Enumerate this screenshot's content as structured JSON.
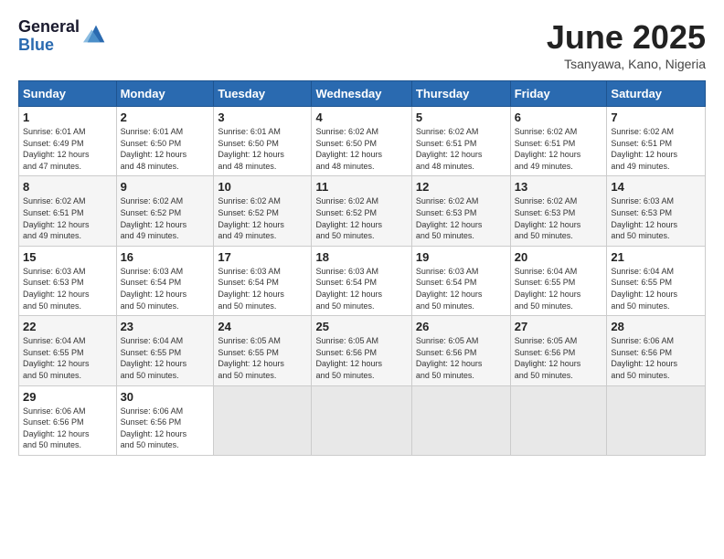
{
  "header": {
    "logo_general": "General",
    "logo_blue": "Blue",
    "month_year": "June 2025",
    "location": "Tsanyawa, Kano, Nigeria"
  },
  "weekdays": [
    "Sunday",
    "Monday",
    "Tuesday",
    "Wednesday",
    "Thursday",
    "Friday",
    "Saturday"
  ],
  "weeks": [
    [
      {
        "day": "1",
        "info": "Sunrise: 6:01 AM\nSunset: 6:49 PM\nDaylight: 12 hours\nand 47 minutes."
      },
      {
        "day": "2",
        "info": "Sunrise: 6:01 AM\nSunset: 6:50 PM\nDaylight: 12 hours\nand 48 minutes."
      },
      {
        "day": "3",
        "info": "Sunrise: 6:01 AM\nSunset: 6:50 PM\nDaylight: 12 hours\nand 48 minutes."
      },
      {
        "day": "4",
        "info": "Sunrise: 6:02 AM\nSunset: 6:50 PM\nDaylight: 12 hours\nand 48 minutes."
      },
      {
        "day": "5",
        "info": "Sunrise: 6:02 AM\nSunset: 6:51 PM\nDaylight: 12 hours\nand 48 minutes."
      },
      {
        "day": "6",
        "info": "Sunrise: 6:02 AM\nSunset: 6:51 PM\nDaylight: 12 hours\nand 49 minutes."
      },
      {
        "day": "7",
        "info": "Sunrise: 6:02 AM\nSunset: 6:51 PM\nDaylight: 12 hours\nand 49 minutes."
      }
    ],
    [
      {
        "day": "8",
        "info": "Sunrise: 6:02 AM\nSunset: 6:51 PM\nDaylight: 12 hours\nand 49 minutes."
      },
      {
        "day": "9",
        "info": "Sunrise: 6:02 AM\nSunset: 6:52 PM\nDaylight: 12 hours\nand 49 minutes."
      },
      {
        "day": "10",
        "info": "Sunrise: 6:02 AM\nSunset: 6:52 PM\nDaylight: 12 hours\nand 49 minutes."
      },
      {
        "day": "11",
        "info": "Sunrise: 6:02 AM\nSunset: 6:52 PM\nDaylight: 12 hours\nand 50 minutes."
      },
      {
        "day": "12",
        "info": "Sunrise: 6:02 AM\nSunset: 6:53 PM\nDaylight: 12 hours\nand 50 minutes."
      },
      {
        "day": "13",
        "info": "Sunrise: 6:02 AM\nSunset: 6:53 PM\nDaylight: 12 hours\nand 50 minutes."
      },
      {
        "day": "14",
        "info": "Sunrise: 6:03 AM\nSunset: 6:53 PM\nDaylight: 12 hours\nand 50 minutes."
      }
    ],
    [
      {
        "day": "15",
        "info": "Sunrise: 6:03 AM\nSunset: 6:53 PM\nDaylight: 12 hours\nand 50 minutes."
      },
      {
        "day": "16",
        "info": "Sunrise: 6:03 AM\nSunset: 6:54 PM\nDaylight: 12 hours\nand 50 minutes."
      },
      {
        "day": "17",
        "info": "Sunrise: 6:03 AM\nSunset: 6:54 PM\nDaylight: 12 hours\nand 50 minutes."
      },
      {
        "day": "18",
        "info": "Sunrise: 6:03 AM\nSunset: 6:54 PM\nDaylight: 12 hours\nand 50 minutes."
      },
      {
        "day": "19",
        "info": "Sunrise: 6:03 AM\nSunset: 6:54 PM\nDaylight: 12 hours\nand 50 minutes."
      },
      {
        "day": "20",
        "info": "Sunrise: 6:04 AM\nSunset: 6:55 PM\nDaylight: 12 hours\nand 50 minutes."
      },
      {
        "day": "21",
        "info": "Sunrise: 6:04 AM\nSunset: 6:55 PM\nDaylight: 12 hours\nand 50 minutes."
      }
    ],
    [
      {
        "day": "22",
        "info": "Sunrise: 6:04 AM\nSunset: 6:55 PM\nDaylight: 12 hours\nand 50 minutes."
      },
      {
        "day": "23",
        "info": "Sunrise: 6:04 AM\nSunset: 6:55 PM\nDaylight: 12 hours\nand 50 minutes."
      },
      {
        "day": "24",
        "info": "Sunrise: 6:05 AM\nSunset: 6:55 PM\nDaylight: 12 hours\nand 50 minutes."
      },
      {
        "day": "25",
        "info": "Sunrise: 6:05 AM\nSunset: 6:56 PM\nDaylight: 12 hours\nand 50 minutes."
      },
      {
        "day": "26",
        "info": "Sunrise: 6:05 AM\nSunset: 6:56 PM\nDaylight: 12 hours\nand 50 minutes."
      },
      {
        "day": "27",
        "info": "Sunrise: 6:05 AM\nSunset: 6:56 PM\nDaylight: 12 hours\nand 50 minutes."
      },
      {
        "day": "28",
        "info": "Sunrise: 6:06 AM\nSunset: 6:56 PM\nDaylight: 12 hours\nand 50 minutes."
      }
    ],
    [
      {
        "day": "29",
        "info": "Sunrise: 6:06 AM\nSunset: 6:56 PM\nDaylight: 12 hours\nand 50 minutes."
      },
      {
        "day": "30",
        "info": "Sunrise: 6:06 AM\nSunset: 6:56 PM\nDaylight: 12 hours\nand 50 minutes."
      },
      {
        "day": "",
        "info": ""
      },
      {
        "day": "",
        "info": ""
      },
      {
        "day": "",
        "info": ""
      },
      {
        "day": "",
        "info": ""
      },
      {
        "day": "",
        "info": ""
      }
    ]
  ]
}
